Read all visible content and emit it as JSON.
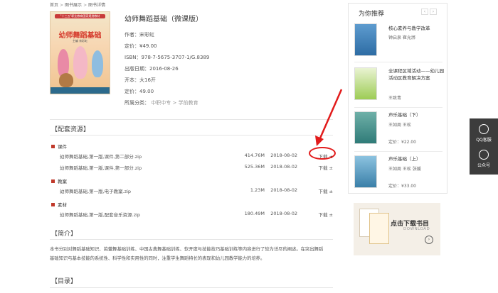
{
  "breadcrumb": [
    "首页",
    "图书展示",
    "图书详情"
  ],
  "breadcrumb_sep": ">",
  "cover": {
    "band_text": "\"十三五\"职业教育国家规划教材",
    "title": "幼师舞蹈基础",
    "author": "主编 宋彩虹"
  },
  "book": {
    "title": "幼师舞蹈基础（微课版）",
    "author": "作者：宋彩虹",
    "list_price": "定价：¥49.00",
    "isbn": "ISBN：978-7-5675-3707-1/G.8389",
    "pub_date": "出版日期：2016-08-26",
    "format": "开本：大16开",
    "price2": "定价：49.00",
    "category_label": "所属分类：",
    "category_1": "中职中专",
    "category_sep": ">",
    "category_2": "学前教育"
  },
  "resources": {
    "heading": "【配套资源】",
    "groups": [
      {
        "label": "课件",
        "files": [
          {
            "name": "幼师舞蹈基础,第一版,课件,第二部分.zip",
            "size": "414.76M",
            "date": "2018-08-02",
            "dl": "下载 ±"
          },
          {
            "name": "幼师舞蹈基础,第一版,课件,第一部分.zip",
            "size": "525.36M",
            "date": "2018-08-02",
            "dl": "下载 ±"
          }
        ]
      },
      {
        "label": "教案",
        "files": [
          {
            "name": "幼师舞蹈基础,第一版,电子教案.zip",
            "size": "1.23M",
            "date": "2018-08-02",
            "dl": "下载 ±"
          }
        ]
      },
      {
        "label": "素材",
        "files": [
          {
            "name": "幼师舞蹈基础,第一版,配套音乐资源.zip",
            "size": "180.49M",
            "date": "2018-08-02",
            "dl": "下载 ±"
          }
        ]
      }
    ]
  },
  "intro": {
    "heading": "【简介】",
    "line1": "本书分别对舞蹈基础知识、芭蕾舞基础训练、中国古典舞基础训练、软开度与技能技巧基础训练等内容进行了较为详尽的阐述。在突出舞蹈",
    "line2": "基础知识与基本技能的系统性、科学性和实用性的同时，注重学生舞蹈特长的表现和幼儿园教学能力的培养。"
  },
  "toc": {
    "heading": "【目录】"
  },
  "sidebar": {
    "heading": "为你推荐",
    "prev": "‹",
    "next": "›",
    "items": [
      {
        "title": "核心素养与教学改革",
        "author": "钟启泉 崔允漷",
        "price": "",
        "color": "#3f7fb6"
      },
      {
        "title": "全课程区域活动——幼儿园活动区教育解决方案",
        "author": "王致青",
        "price": "",
        "color": "#8fc24a"
      },
      {
        "title": "声乐基础（下）",
        "author": "王如周 王松",
        "price": "定价：¥22.00",
        "color": "#3c8c8a"
      },
      {
        "title": "声乐基础（上）",
        "author": "王如周 王松 张媛",
        "price": "定价：¥33.00",
        "color": "#4a8fb3"
      }
    ]
  },
  "banner": {
    "title": "点击下载书目",
    "subtitle": "DOWNLOAD",
    "icon": "›"
  },
  "float": {
    "qq": "QQ客服",
    "wechat": "公众号"
  },
  "colors": {
    "accent": "#c0392b",
    "annotation": "#e21b1b",
    "float_bg": "#3c3c3c"
  }
}
